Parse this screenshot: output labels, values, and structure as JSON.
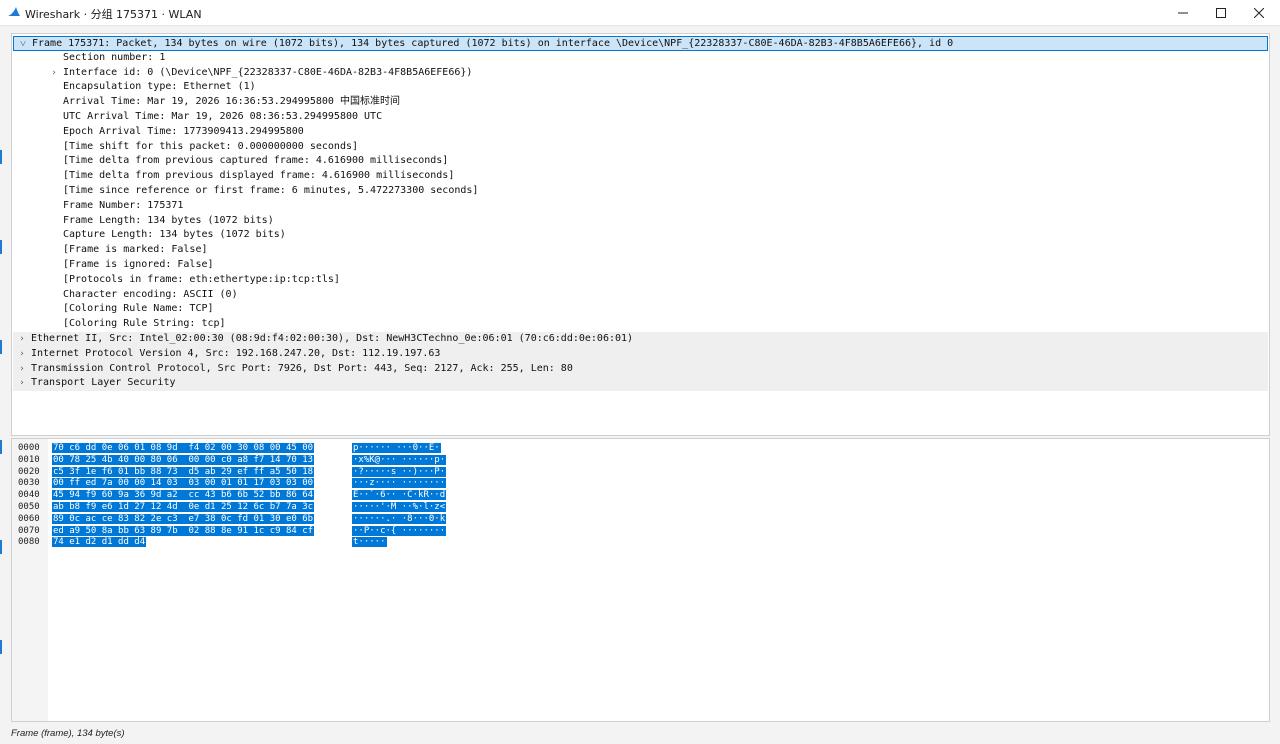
{
  "window": {
    "title": "Wireshark · 分组 175371 · WLAN"
  },
  "tree": {
    "rows": [
      {
        "text": "Frame 175371: Packet, 134 bytes on wire (1072 bits), 134 bytes captured (1072 bits) on interface \\Device\\NPF_{22328337-C80E-46DA-82B3-4F8B5A6EFE66}, id 0",
        "indent": 0,
        "expander": "expanded",
        "state": "selected"
      },
      {
        "text": "Section number: 1",
        "indent": 2,
        "expander": "none",
        "state": "normal"
      },
      {
        "text": "Interface id: 0 (\\Device\\NPF_{22328337-C80E-46DA-82B3-4F8B5A6EFE66})",
        "indent": 2,
        "expander": "collapsed",
        "state": "normal"
      },
      {
        "text": "Encapsulation type: Ethernet (1)",
        "indent": 2,
        "expander": "none",
        "state": "normal"
      },
      {
        "text": "Arrival Time: Mar 19, 2026 16:36:53.294995800 中国标准时间",
        "indent": 2,
        "expander": "none",
        "state": "normal"
      },
      {
        "text": "UTC Arrival Time: Mar 19, 2026 08:36:53.294995800 UTC",
        "indent": 2,
        "expander": "none",
        "state": "normal"
      },
      {
        "text": "Epoch Arrival Time: 1773909413.294995800",
        "indent": 2,
        "expander": "none",
        "state": "normal"
      },
      {
        "text": "[Time shift for this packet: 0.000000000 seconds]",
        "indent": 2,
        "expander": "none",
        "state": "normal"
      },
      {
        "text": "[Time delta from previous captured frame: 4.616900 milliseconds]",
        "indent": 2,
        "expander": "none",
        "state": "normal"
      },
      {
        "text": "[Time delta from previous displayed frame: 4.616900 milliseconds]",
        "indent": 2,
        "expander": "none",
        "state": "normal"
      },
      {
        "text": "[Time since reference or first frame: 6 minutes, 5.472273300 seconds]",
        "indent": 2,
        "expander": "none",
        "state": "normal"
      },
      {
        "text": "Frame Number: 175371",
        "indent": 2,
        "expander": "none",
        "state": "normal"
      },
      {
        "text": "Frame Length: 134 bytes (1072 bits)",
        "indent": 2,
        "expander": "none",
        "state": "normal"
      },
      {
        "text": "Capture Length: 134 bytes (1072 bits)",
        "indent": 2,
        "expander": "none",
        "state": "normal"
      },
      {
        "text": "[Frame is marked: False]",
        "indent": 2,
        "expander": "none",
        "state": "normal"
      },
      {
        "text": "[Frame is ignored: False]",
        "indent": 2,
        "expander": "none",
        "state": "normal"
      },
      {
        "text": "[Protocols in frame: eth:ethertype:ip:tcp:tls]",
        "indent": 2,
        "expander": "none",
        "state": "normal"
      },
      {
        "text": "Character encoding: ASCII (0)",
        "indent": 2,
        "expander": "none",
        "state": "normal"
      },
      {
        "text": "[Coloring Rule Name: TCP]",
        "indent": 2,
        "expander": "none",
        "state": "normal"
      },
      {
        "text": "[Coloring Rule String: tcp]",
        "indent": 2,
        "expander": "none",
        "state": "normal"
      },
      {
        "text": "Ethernet II, Src: Intel_02:00:30 (08:9d:f4:02:00:30), Dst: NewH3CTechno_0e:06:01 (70:c6:dd:0e:06:01)",
        "indent": 0,
        "expander": "collapsed",
        "state": "grey"
      },
      {
        "text": "Internet Protocol Version 4, Src: 192.168.247.20, Dst: 112.19.197.63",
        "indent": 0,
        "expander": "collapsed",
        "state": "grey"
      },
      {
        "text": "Transmission Control Protocol, Src Port: 7926, Dst Port: 443, Seq: 2127, Ack: 255, Len: 80",
        "indent": 0,
        "expander": "collapsed",
        "state": "grey"
      },
      {
        "text": "Transport Layer Security",
        "indent": 0,
        "expander": "collapsed",
        "state": "grey"
      }
    ]
  },
  "hex": {
    "lines": [
      {
        "offset": "0000",
        "hex": "70 c6 dd 0e 06 01 08 9d  f4 02 00 30 08 00 45 00",
        "ascii": "p······ ···0··E·"
      },
      {
        "offset": "0010",
        "hex": "00 78 25 4b 40 00 80 06  00 00 c0 a8 f7 14 70 13",
        "ascii": "·x%K@··· ······p·"
      },
      {
        "offset": "0020",
        "hex": "c5 3f 1e f6 01 bb 88 73  d5 ab 29 ef ff a5 50 18",
        "ascii": "·?·····s ··)···P·"
      },
      {
        "offset": "0030",
        "hex": "00 ff ed 7a 00 00 14 03  03 00 01 01 17 03 03 00",
        "ascii": "···z···· ········"
      },
      {
        "offset": "0040",
        "hex": "45 94 f9 60 9a 36 9d a2  cc 43 b6 6b 52 bb 86 64",
        "ascii": "E··`·6·· ·C·kR··d"
      },
      {
        "offset": "0050",
        "hex": "ab b8 f9 e6 1d 27 12 4d  0e d1 25 12 6c b7 7a 3c",
        "ascii": "·····'·M ··%·l·z<"
      },
      {
        "offset": "0060",
        "hex": "89 0c ac ce 83 82 2e c3  e7 38 0c fd 01 30 e0 6b",
        "ascii": "······.· ·8···0·k"
      },
      {
        "offset": "0070",
        "hex": "ed a9 50 8a bb 63 89 7b  02 88 8e 91 1c c9 84 cf",
        "ascii": "··P··c·{ ········"
      },
      {
        "offset": "0080",
        "hex": "74 e1 d2 d1 dd d4",
        "ascii": "t·····"
      }
    ]
  },
  "status": {
    "text": "Frame (frame), 134 byte(s)"
  },
  "colors": {
    "selection": "#0078d7",
    "tree_selected_bg": "#cce4f7",
    "protocol_row_bg": "#efefef"
  }
}
